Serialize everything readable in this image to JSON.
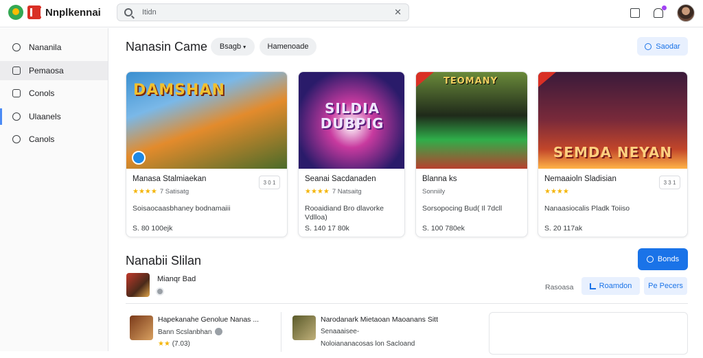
{
  "app": {
    "name": "Nnplkennai"
  },
  "search": {
    "value": "Itidn",
    "clear_glyph": "✕"
  },
  "sidebar": {
    "items": [
      {
        "label": "Nananila",
        "icon": "pin-icon"
      },
      {
        "label": "Pemaosa",
        "icon": "doc-icon"
      },
      {
        "label": "Conols",
        "icon": "list-icon"
      },
      {
        "label": "Ulaanels",
        "icon": "gear-icon"
      },
      {
        "label": "Canols",
        "icon": "chat-icon"
      }
    ]
  },
  "header": {
    "title": "Nanasin Came",
    "genre_chip": "Bsagb",
    "filter_chip": "Hamenoade",
    "action_label": "Saodar"
  },
  "cards": [
    {
      "art_title": "DAMSHAN",
      "name": "Manasa Stalmiaekan",
      "stars": "★★★★",
      "count": "7 Satisatg",
      "desc": "Soisaocaasbhaney bodnamaiii",
      "price": "S. 80 100ejk",
      "more": "3 0 1",
      "colors": [
        "#3a8fd0",
        "#e38b2c",
        "#4a6b2a"
      ]
    },
    {
      "art_title": "SILDIA DUBPIG",
      "name": "Seanai Sacdanaden",
      "stars": "★★★★",
      "count": "7 Natsaitg",
      "desc": "Rooaidiand Bro dlavorke Vdlloa)",
      "price": "S. 140 17 80k",
      "more": "",
      "colors": [
        "#2a1b6a",
        "#c83a9f",
        "#4fb3ff"
      ]
    },
    {
      "art_title": "TEOMANY",
      "name": "Blanna ks",
      "stars": "",
      "count": "Sonniily",
      "desc": "Sorsopocing Bud( Il 7dcll",
      "price": "S. 100 780ek",
      "more": "",
      "colors": [
        "#1f2a1a",
        "#2fae4a",
        "#b8402e"
      ]
    },
    {
      "art_title": "SEMDA NEYAN",
      "name": "Nemaaioln Sladisian",
      "stars": "★★★★",
      "count": "",
      "desc": "Nanaasiocalis Pladk Toiiso",
      "price": "S. 20 117ak",
      "more": "3 3 1",
      "colors": [
        "#3a1a3a",
        "#c2462a",
        "#ffb347"
      ]
    }
  ],
  "section": {
    "title": "Nanabii Slilan",
    "button_label": "Bonds",
    "developer": "Mianqr Bad",
    "sort_label": "Rasoasa",
    "recommended_label": "Roamdon",
    "popular_label": "Pe Pecers"
  },
  "list": [
    {
      "name": "Hapekanahe Genolue  Nanas  ...",
      "sub": "Bann Scslanbhan",
      "third": "(7.03)",
      "stars": "★★",
      "colors": [
        "#7a3a1a",
        "#d8a060"
      ]
    },
    {
      "name": "Narodanark Mietaoan Maoanans  Sitt",
      "sub": "Senaaaisee-",
      "third": "Noloiananacosas lon Sacloand",
      "stars": "",
      "colors": [
        "#5a5a2a",
        "#c0b07a"
      ]
    }
  ],
  "accent_color": "#1a73e8",
  "star_color": "#f4b400"
}
